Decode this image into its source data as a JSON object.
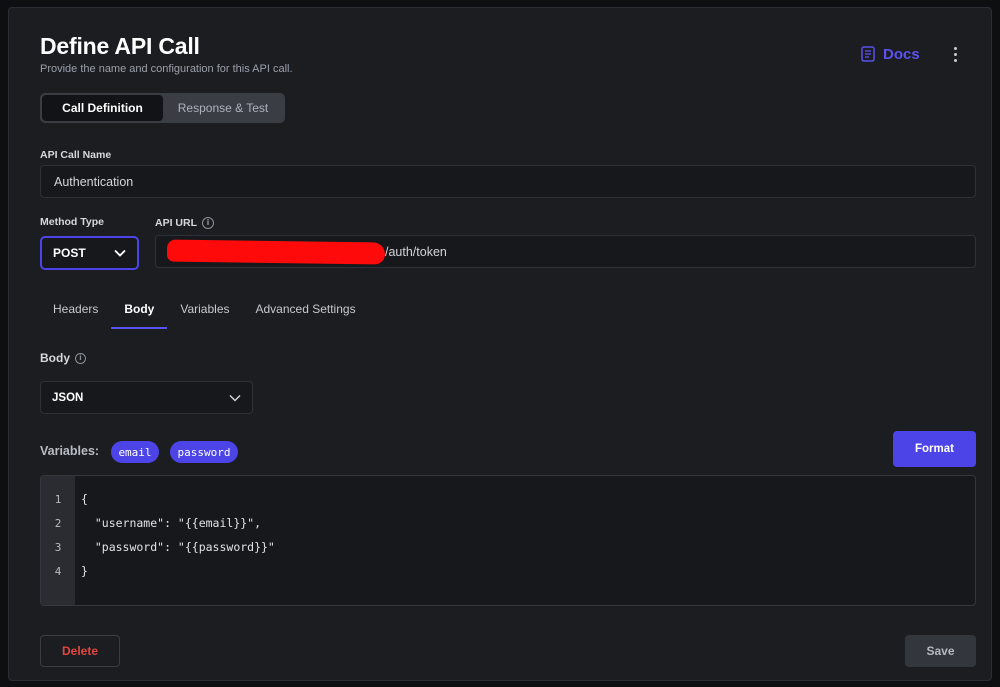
{
  "header": {
    "title": "Define API Call",
    "subtitle": "Provide the name and configuration for this API call.",
    "docs_label": "Docs",
    "docs_icon": "document-icon",
    "more_icon": "more-vertical-icon"
  },
  "segmented": {
    "options": [
      "Call Definition",
      "Response & Test"
    ],
    "selected": "Call Definition"
  },
  "api_call_name": {
    "label": "API Call Name",
    "value": "Authentication"
  },
  "method_type": {
    "label": "Method Type",
    "value": "POST"
  },
  "api_url": {
    "label": "API URL",
    "visible_value": "/auth/token",
    "redacted": true
  },
  "config_tabs": {
    "items": [
      "Headers",
      "Body",
      "Variables",
      "Advanced Settings"
    ],
    "selected": "Body"
  },
  "body": {
    "label": "Body",
    "type": "JSON"
  },
  "variables": {
    "label": "Variables:",
    "chips": [
      "email",
      "password"
    ]
  },
  "format_label": "Format",
  "editor": {
    "line_numbers": [
      "1",
      "2",
      "3",
      "4"
    ],
    "lines": [
      "{",
      "  \"username\": \"{{email}}\",",
      "  \"password\": \"{{password}}\"",
      "}"
    ]
  },
  "footer": {
    "delete_label": "Delete",
    "save_label": "Save"
  },
  "colors": {
    "accent": "#4c44e6",
    "danger": "#e2473f",
    "panel_bg": "#1b1d21"
  }
}
